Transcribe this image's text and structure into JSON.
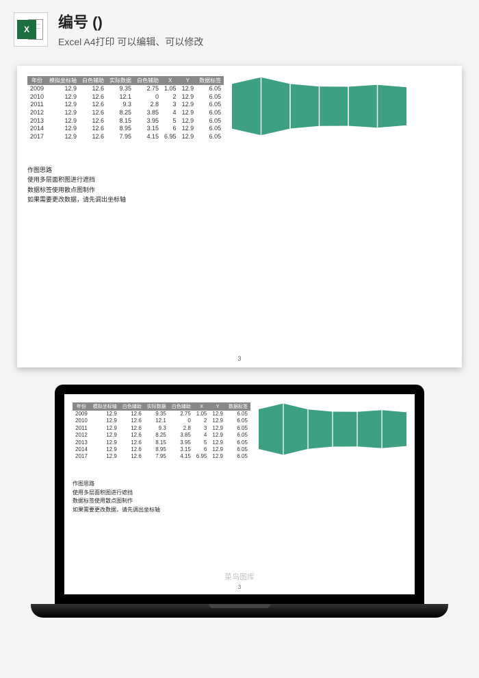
{
  "header": {
    "title": "编号 ()",
    "subtitle": "Excel A4打印 可以编辑、可以修改",
    "icon_letter": "X"
  },
  "table": {
    "headers": [
      "年份",
      "模拟坐标轴",
      "白色辅助",
      "实际数据",
      "白色辅助",
      "X",
      "Y",
      "数据标签"
    ],
    "rows": [
      [
        "2009",
        "12.9",
        "12.6",
        "9.35",
        "2.75",
        "1.05",
        "12.9",
        "6.05"
      ],
      [
        "2010",
        "12.9",
        "12.6",
        "12.1",
        "0",
        "2",
        "12.9",
        "6.05"
      ],
      [
        "2011",
        "12.9",
        "12.6",
        "9.3",
        "2.8",
        "3",
        "12.9",
        "6.05"
      ],
      [
        "2012",
        "12.9",
        "12.6",
        "8.25",
        "3.85",
        "4",
        "12.9",
        "6.05"
      ],
      [
        "2013",
        "12.9",
        "12.6",
        "8.15",
        "3.95",
        "5",
        "12.9",
        "6.05"
      ],
      [
        "2014",
        "12.9",
        "12.6",
        "8.95",
        "3.15",
        "6",
        "12.9",
        "6.05"
      ],
      [
        "2017",
        "12.9",
        "12.6",
        "7.95",
        "4.15",
        "6.95",
        "12.9",
        "6.05"
      ]
    ]
  },
  "notes": {
    "line1": "作图思路",
    "line2": "使用多层面积图进行遮挡",
    "line3": "数据标签使用散点图制作",
    "line4": "如果需要更改数据，请先调出坐标轴"
  },
  "page_number": "3",
  "watermark": "菜鸟图库",
  "chart_data": {
    "type": "area",
    "title": "",
    "xlabel": "",
    "ylabel": "",
    "categories": [
      "2009",
      "2010",
      "2011",
      "2012",
      "2013",
      "2014",
      "2017"
    ],
    "series": [
      {
        "name": "实际数据",
        "values": [
          9.35,
          12.1,
          9.3,
          8.25,
          8.15,
          8.95,
          7.95
        ]
      },
      {
        "name": "白色辅助",
        "values": [
          2.75,
          0,
          2.8,
          3.85,
          3.95,
          3.15,
          4.15
        ]
      }
    ],
    "ylim": [
      0,
      12.6
    ],
    "color": "#3ea082"
  }
}
